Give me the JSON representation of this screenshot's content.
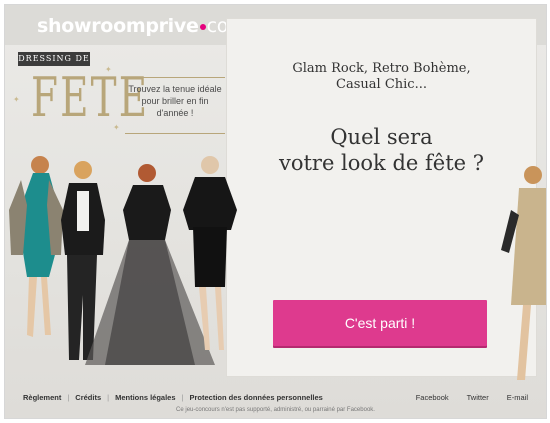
{
  "header": {
    "logo_main": "showroomprive",
    "logo_suffix": "com"
  },
  "promo": {
    "badge": "DRESSING DE",
    "title": "FETE",
    "tagline": "Trouvez la tenue idéale pour briller en fin d'année !"
  },
  "panel": {
    "subtitle_line1": "Glam Rock, Retro Bohème,",
    "subtitle_line2": "Casual Chic...",
    "question_line1": "Quel sera",
    "question_line2": "votre look de fête ?",
    "cta_label": "C'est parti !"
  },
  "footer": {
    "links": [
      "Règlement",
      "Crédits",
      "Mentions légales",
      "Protection des données personnelles"
    ],
    "social": [
      "Facebook",
      "Twitter",
      "E-mail"
    ],
    "disclaimer": "Ce jeu-concours n'est pas supporté, administré, ou parrainé par Facebook."
  },
  "colors": {
    "accent": "#de3a8e",
    "gold": "#b8a67a"
  }
}
